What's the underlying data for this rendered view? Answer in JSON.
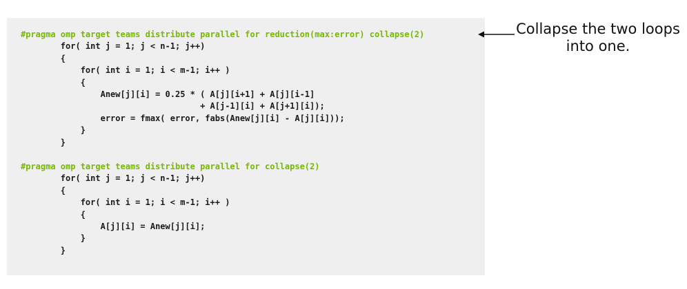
{
  "colors": {
    "pragma": "#76b900",
    "code_text": "#1a1a1a",
    "panel_background": "#efefef"
  },
  "code_blocks": [
    {
      "lines": [
        "#pragma omp target teams distribute parallel for reduction(max:error) collapse(2)",
        "        for( int j = 1; j < n-1; j++)",
        "        {",
        "            for( int i = 1; i < m-1; i++ )",
        "            {",
        "                Anew[j][i] = 0.25 * ( A[j][i+1] + A[j][i-1]",
        "                                    + A[j-1][i] + A[j+1][i]);",
        "                error = fmax( error, fabs(Anew[j][i] - A[j][i]));",
        "            }",
        "        }"
      ]
    },
    {
      "lines": [
        "#pragma omp target teams distribute parallel for collapse(2)",
        "        for( int j = 1; j < n-1; j++)",
        "        {",
        "            for( int i = 1; i < m-1; i++ )",
        "            {",
        "                A[j][i] = Anew[j][i];",
        "            }",
        "        }"
      ]
    }
  ],
  "annotation": {
    "line1": "Collapse the two loops",
    "line2": "into one."
  }
}
